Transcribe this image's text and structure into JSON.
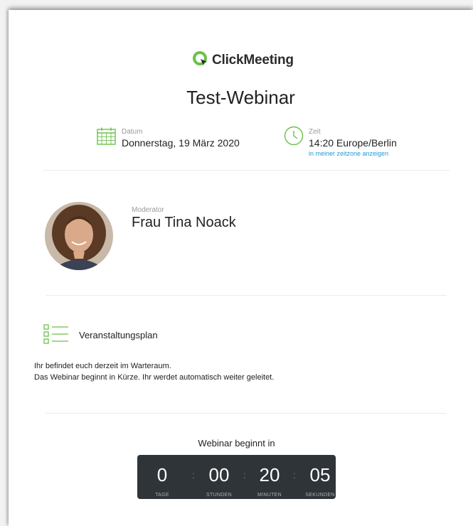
{
  "header": {
    "logo_text": "ClickMeeting",
    "brand_color": "#6cc04a"
  },
  "event": {
    "title": "Test-Webinar",
    "date_label": "Datum",
    "date_value": "Donnerstag, 19 März 2020",
    "time_label": "Zeit",
    "time_value": "14:20 Europe/Berlin",
    "timezone_link": "in meiner zeitzone anzeigen"
  },
  "moderator": {
    "label": "Moderator",
    "name": "Frau Tina Noack"
  },
  "agenda": {
    "title": "Veranstaltungsplan",
    "line1": "Ihr befindet euch derzeit im Warteraum.",
    "line2": "Das Webinar beginnt in Kürze. Ihr werdet automatisch weiter geleitet."
  },
  "countdown": {
    "label": "Webinar beginnt in",
    "days": "0",
    "hours": "00",
    "minutes": "20",
    "seconds": "05",
    "days_unit": "TAGE",
    "hours_unit": "STUNDEN",
    "minutes_unit": "MINUTEN",
    "seconds_unit": "SEKUNDEN"
  },
  "icons": {
    "logo": "clickmeeting-logo-icon",
    "date": "calendar-icon",
    "time": "clock-icon",
    "agenda": "list-icon",
    "accent_color": "#6cc04a",
    "link_color": "#1e9bd7"
  }
}
